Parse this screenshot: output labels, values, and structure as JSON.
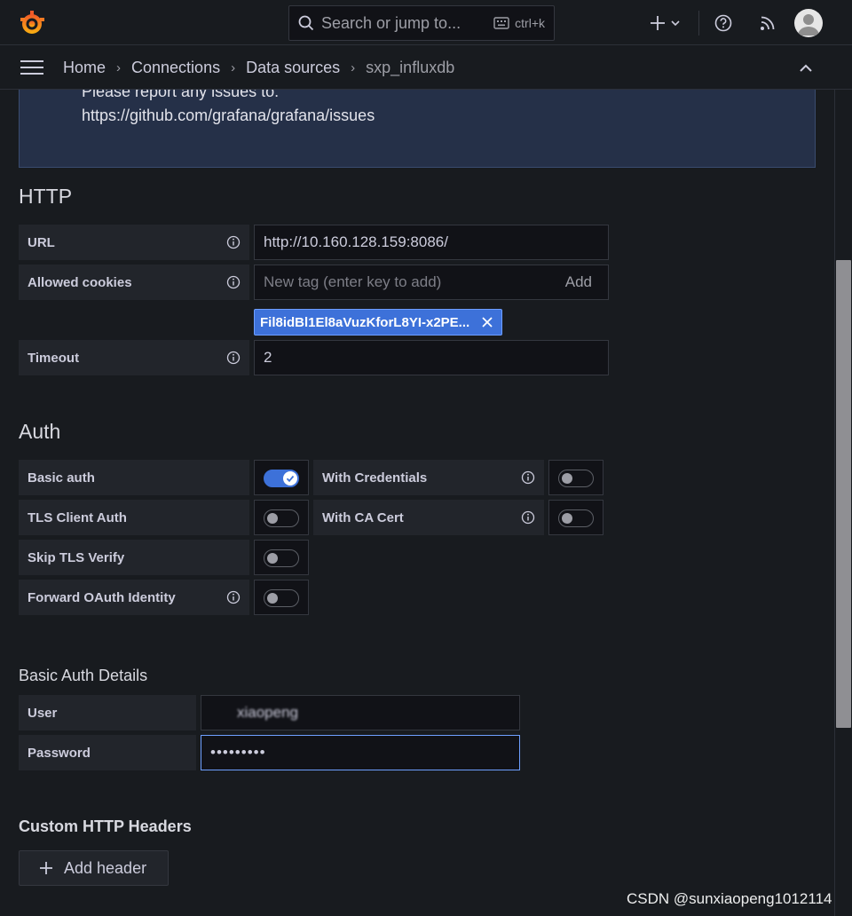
{
  "topbar": {
    "search_placeholder": "Search or jump to...",
    "search_shortcut": "ctrl+k",
    "icons": [
      "grafana-logo",
      "search-icon",
      "keyboard-icon",
      "plus-icon",
      "chevron-down-icon",
      "help-icon",
      "rss-icon",
      "user-avatar"
    ]
  },
  "breadcrumb": {
    "items": [
      "Home",
      "Connections",
      "Data sources",
      "sxp_influxdb"
    ]
  },
  "alert": {
    "line1": "Please report any issues to:",
    "line2": "https://github.com/grafana/grafana/issues"
  },
  "http": {
    "title": "HTTP",
    "url_label": "URL",
    "url_value": "http://10.160.128.159:8086/",
    "cookies_label": "Allowed cookies",
    "cookies_placeholder": "New tag (enter key to add)",
    "cookies_add": "Add",
    "cookie_tag": "Fil8idBl1El8aVuzKforL8YI-x2PE...",
    "timeout_label": "Timeout",
    "timeout_value": "2"
  },
  "auth": {
    "title": "Auth",
    "basic_auth": "Basic auth",
    "with_credentials": "With Credentials",
    "tls_client_auth": "TLS Client Auth",
    "with_ca_cert": "With CA Cert",
    "skip_tls_verify": "Skip TLS Verify",
    "forward_oauth": "Forward OAuth Identity",
    "toggles": {
      "basic_auth": true,
      "with_credentials": false,
      "tls_client_auth": false,
      "with_ca_cert": false,
      "skip_tls_verify": false,
      "forward_oauth": false
    }
  },
  "basic_auth_details": {
    "title": "Basic Auth Details",
    "user_label": "User",
    "user_value": "xiaopeng",
    "password_label": "Password",
    "password_value": "•••••••••"
  },
  "custom_headers": {
    "title": "Custom HTTP Headers",
    "add_button": "Add header"
  },
  "watermark": "CSDN @sunxiaopeng1012114",
  "colors": {
    "background": "#181b1f",
    "accent": "#3d71d9",
    "alert_bg": "#253048"
  }
}
